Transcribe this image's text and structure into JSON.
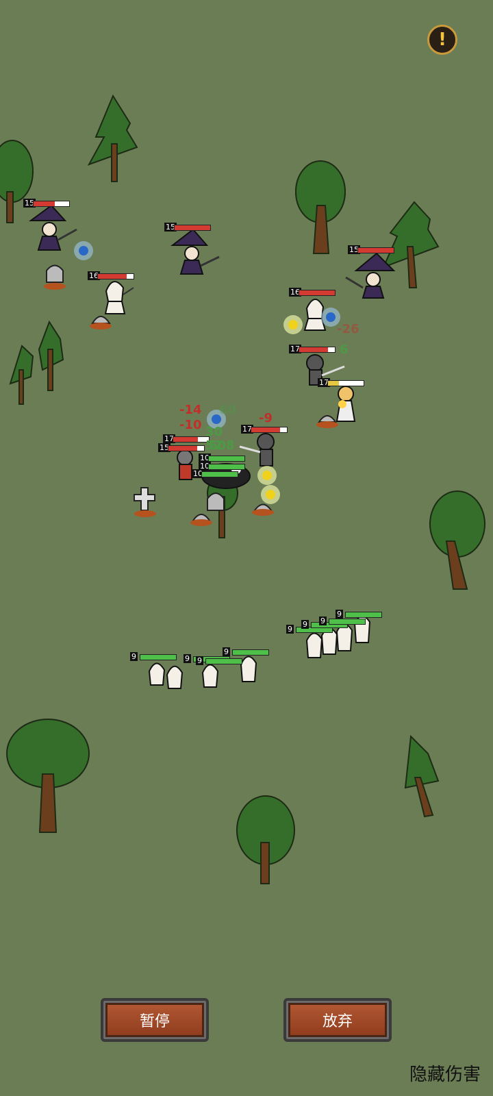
{
  "hud": {
    "alert_icon": "!",
    "pause_label": "暂停",
    "give_up_label": "放弃",
    "hide_damage_label": "隐藏伤害"
  },
  "units": [
    {
      "level": "15",
      "hp": 0.6,
      "type": "witch"
    },
    {
      "level": "15",
      "hp": 1.0,
      "type": "witch"
    },
    {
      "level": "15",
      "hp": 1.0,
      "type": "witch"
    },
    {
      "level": "16",
      "hp": 0.8,
      "type": "priest"
    },
    {
      "level": "16",
      "hp": 1.0,
      "type": "priest"
    },
    {
      "level": "17",
      "hp": 0.8,
      "type": "knight"
    },
    {
      "level": "17",
      "hp": 0.3,
      "type": "archer"
    },
    {
      "level": "17",
      "hp": 0.8,
      "type": "knight"
    },
    {
      "level": "17",
      "hp": 0.7,
      "type": "knight"
    },
    {
      "level": "15",
      "hp": 0.8,
      "type": "knight"
    },
    {
      "level": "10",
      "hp": 1.0,
      "type": "ally"
    },
    {
      "level": "10",
      "hp": 1.0,
      "type": "ally"
    },
    {
      "level": "10",
      "hp": 1.0,
      "type": "ally"
    },
    {
      "level": "9",
      "hp": 1.0,
      "type": "ally-priest"
    },
    {
      "level": "9",
      "hp": 1.0,
      "type": "ally-priest"
    },
    {
      "level": "9",
      "hp": 1.0,
      "type": "ally-priest"
    },
    {
      "level": "9",
      "hp": 1.0,
      "type": "ally-priest"
    },
    {
      "level": "9",
      "hp": 1.0,
      "type": "ally-priest"
    },
    {
      "level": "9",
      "hp": 1.0,
      "type": "ally-priest"
    },
    {
      "level": "9",
      "hp": 1.0,
      "type": "ally-priest"
    },
    {
      "level": "9",
      "hp": 1.0,
      "type": "ally-priest"
    }
  ],
  "damage_numbers": [
    "-10",
    "-9",
    "-26",
    "6",
    "30",
    "52",
    "-14",
    "60",
    "608"
  ],
  "colors": {
    "ground": "#6b7d55",
    "enemy_hp": "#d23a32",
    "ally_hp": "#4ec04a",
    "archer_hp": "#e6c940",
    "damage_text": "#c0302a",
    "heal_text": "#4c9a46"
  }
}
